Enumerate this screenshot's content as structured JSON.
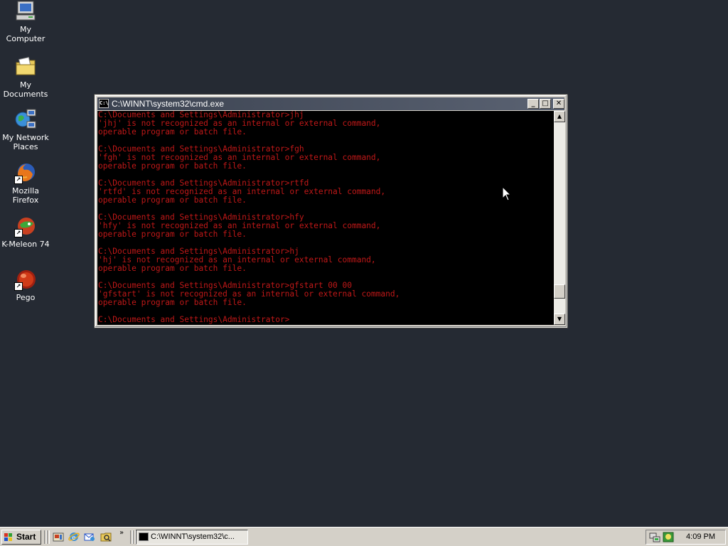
{
  "desktop": {
    "icons": [
      {
        "label": "My Computer",
        "icon": "my-computer-icon"
      },
      {
        "label": "My Documents",
        "icon": "my-documents-icon"
      },
      {
        "label_line1": "My Network",
        "label_line2": "Places",
        "icon": "network-places-icon"
      },
      {
        "label": "Mozilla Firefox",
        "icon": "firefox-icon"
      },
      {
        "label": "K-Meleon 74",
        "icon": "k-meleon-icon"
      },
      {
        "label": "Pego",
        "icon": "pego-icon"
      }
    ]
  },
  "window": {
    "title": "C:\\WINNT\\system32\\cmd.exe",
    "minimize": "_",
    "maximize": "□",
    "close": "✕",
    "console_lines": [
      "C:\\Documents and Settings\\Administrator>jhj",
      "'jhj' is not recognized as an internal or external command,",
      "operable program or batch file.",
      "",
      "C:\\Documents and Settings\\Administrator>fgh",
      "'fgh' is not recognized as an internal or external command,",
      "operable program or batch file.",
      "",
      "C:\\Documents and Settings\\Administrator>rtfd",
      "'rtfd' is not recognized as an internal or external command,",
      "operable program or batch file.",
      "",
      "C:\\Documents and Settings\\Administrator>hfy",
      "'hfy' is not recognized as an internal or external command,",
      "operable program or batch file.",
      "",
      "C:\\Documents and Settings\\Administrator>hj",
      "'hj' is not recognized as an internal or external command,",
      "operable program or batch file.",
      "",
      "C:\\Documents and Settings\\Administrator>gfstart 00 00",
      "'gfstart' is not recognized as an internal or external command,",
      "operable program or batch file.",
      "",
      "C:\\Documents and Settings\\Administrator>"
    ],
    "text_color": "#c01818",
    "scroll_up": "▲",
    "scroll_down": "▼"
  },
  "taskbar": {
    "start_label": "Start",
    "quicklaunch_more": "»",
    "task_button_label": "C:\\WINNT\\system32\\c...",
    "clock": "4:09 PM"
  }
}
